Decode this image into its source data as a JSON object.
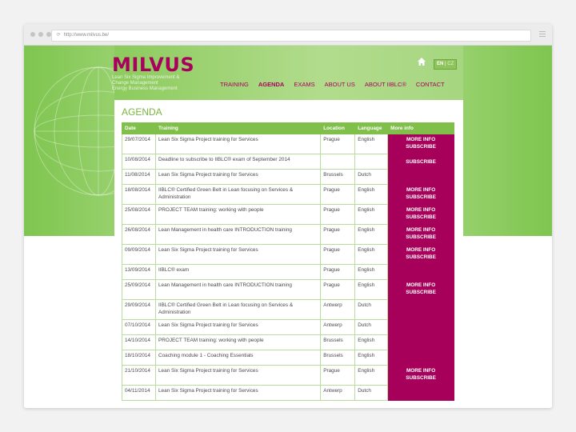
{
  "browser": {
    "url": "http://www.milvus.be/"
  },
  "site": {
    "logo": "MILVUS",
    "tagline": [
      "Lean Six Sigma Improvement &",
      "Change Management",
      "Energy Business Management"
    ],
    "lang_active": "EN",
    "lang_sep": "|",
    "lang_other": "CZ",
    "nav": [
      "TRAINING",
      "AGENDA",
      "EXAMS",
      "ABOUT US",
      "ABOUT IIBLC®",
      "CONTACT"
    ],
    "active_nav": "AGENDA"
  },
  "agenda": {
    "title": "AGENDA",
    "columns": [
      "Date",
      "Training",
      "Location",
      "Language",
      "More info"
    ],
    "more_info_label": "MORE INFO",
    "subscribe_label": "SUBSCRIBE",
    "rows": [
      {
        "date": "29/07/2014",
        "training": "Lean Six Sigma Project training for Services",
        "location": "Prague",
        "language": "English",
        "info": "both"
      },
      {
        "date": "10/08/2014",
        "training": "Deadline to subscribe to IIBLC® exam of September 2014",
        "location": "",
        "language": "",
        "info": "subscribe"
      },
      {
        "date": "11/08/2014",
        "training": "Lean Six Sigma Project training for Services",
        "location": "Brussels",
        "language": "Dutch",
        "info": "none"
      },
      {
        "date": "18/08/2014",
        "training": "IIBLC® Certified Green Belt in Lean focusing on Services & Administration",
        "location": "Prague",
        "language": "English",
        "info": "both"
      },
      {
        "date": "25/08/2014",
        "training": "PROJECT TEAM training: working with people",
        "location": "Prague",
        "language": "English",
        "info": "both"
      },
      {
        "date": "26/08/2014",
        "training": "Lean Management in health care INTRODUCTION training",
        "location": "Prague",
        "language": "English",
        "info": "both"
      },
      {
        "date": "09/09/2014",
        "training": "Lean Six Sigma Project training for Services",
        "location": "Prague",
        "language": "English",
        "info": "both"
      },
      {
        "date": "13/09/2014",
        "training": "IIBLC® exam",
        "location": "Prague",
        "language": "English",
        "info": "none"
      },
      {
        "date": "25/09/2014",
        "training": "Lean Management in health care INTRODUCTION training",
        "location": "Prague",
        "language": "English",
        "info": "both"
      },
      {
        "date": "29/09/2014",
        "training": "IIBLC® Certified Green Belt in Lean focusing on Services & Administration",
        "location": "Antwerp",
        "language": "Dutch",
        "info": "none"
      },
      {
        "date": "07/10/2014",
        "training": "Lean Six Sigma Project training for Services",
        "location": "Antwerp",
        "language": "Dutch",
        "info": "none"
      },
      {
        "date": "14/10/2014",
        "training": "PROJECT TEAM training: working with people",
        "location": "Brussels",
        "language": "English",
        "info": "none"
      },
      {
        "date": "18/10/2014",
        "training": "Coaching module 1 - Coaching Essentials",
        "location": "Brussels",
        "language": "English",
        "info": "none"
      },
      {
        "date": "21/10/2014",
        "training": "Lean Six Sigma Project training for Services",
        "location": "Prague",
        "language": "English",
        "info": "both"
      },
      {
        "date": "04/11/2014",
        "training": "Lean Six Sigma Project training for Services",
        "location": "Antwerp",
        "language": "Dutch",
        "info": "none"
      }
    ]
  }
}
